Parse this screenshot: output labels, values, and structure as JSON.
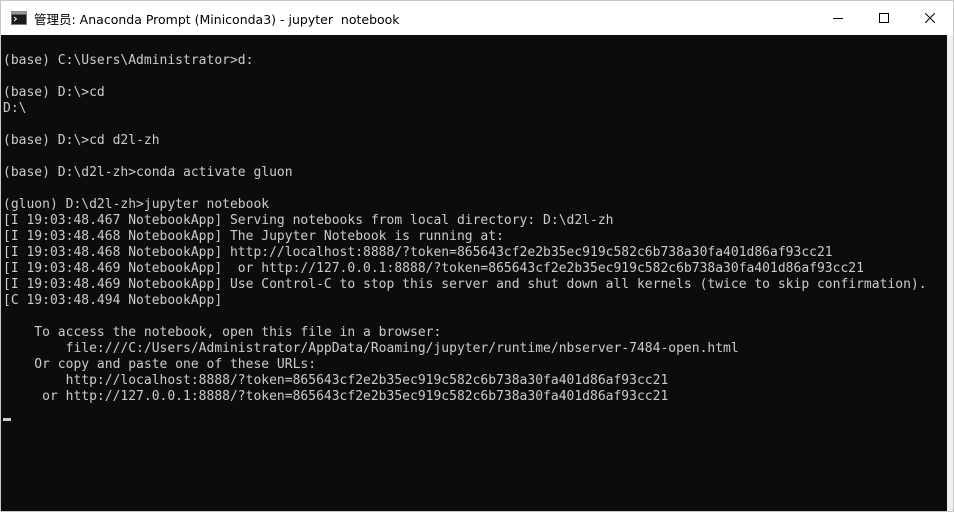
{
  "window": {
    "title": "管理员: Anaconda Prompt (Miniconda3) - jupyter  notebook",
    "icons": {
      "app": "console-icon",
      "minimize": "minimize-icon",
      "maximize": "maximize-icon",
      "close": "close-icon"
    }
  },
  "console": {
    "lines": [
      "(base) C:\\Users\\Administrator>d:",
      "",
      "(base) D:\\>cd",
      "D:\\",
      "",
      "(base) D:\\>cd d2l-zh",
      "",
      "(base) D:\\d2l-zh>conda activate gluon",
      "",
      "(gluon) D:\\d2l-zh>jupyter notebook",
      "[I 19:03:48.467 NotebookApp] Serving notebooks from local directory: D:\\d2l-zh",
      "[I 19:03:48.468 NotebookApp] The Jupyter Notebook is running at:",
      "[I 19:03:48.468 NotebookApp] http://localhost:8888/?token=865643cf2e2b35ec919c582c6b738a30fa401d86af93cc21",
      "[I 19:03:48.469 NotebookApp]  or http://127.0.0.1:8888/?token=865643cf2e2b35ec919c582c6b738a30fa401d86af93cc21",
      "[I 19:03:48.469 NotebookApp] Use Control-C to stop this server and shut down all kernels (twice to skip confirmation).",
      "[C 19:03:48.494 NotebookApp]",
      "",
      "    To access the notebook, open this file in a browser:",
      "        file:///C:/Users/Administrator/AppData/Roaming/jupyter/runtime/nbserver-7484-open.html",
      "    Or copy and paste one of these URLs:",
      "        http://localhost:8888/?token=865643cf2e2b35ec919c582c6b738a30fa401d86af93cc21",
      "     or http://127.0.0.1:8888/?token=865643cf2e2b35ec919c582c6b738a30fa401d86af93cc21"
    ]
  },
  "colors": {
    "console_bg": "#0c0c0c",
    "console_text": "#cccccc",
    "titlebar_bg": "#ffffff"
  }
}
